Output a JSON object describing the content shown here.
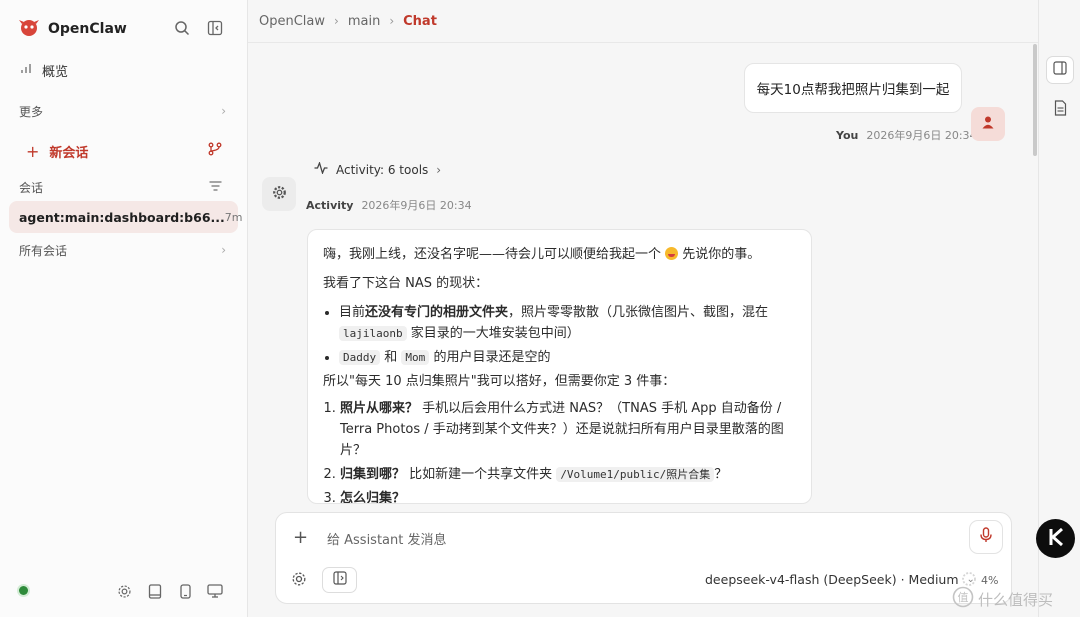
{
  "app": {
    "name": "OpenClaw"
  },
  "sidebar": {
    "overview_label": "概览",
    "more_label": "更多",
    "new_chat_label": "新会话",
    "sessions_label": "会话",
    "active_session": {
      "name": "agent:main:dashboard:b66...",
      "age": "7m"
    },
    "all_sessions_label": "所有会话"
  },
  "breadcrumb": {
    "items": [
      "OpenClaw",
      "main",
      "Chat"
    ]
  },
  "chat": {
    "user_message": {
      "text": "每天10点帮我把照片归集到一起",
      "author": "You",
      "timestamp": "2026年9月6日 20:34"
    },
    "activity_toggle_label": "Activity: 6 tools",
    "assistant_message": {
      "author": "Activity",
      "timestamp": "2026年9月6日 20:34",
      "p1_a": "嗨，我刚上线，还没名字呢——待会儿可以顺便给我起一个",
      "p1_b": "先说你的事。",
      "p2": "我看了下这台 NAS 的现状：",
      "b1_pre": "目前",
      "b1_bold": "还没有专门的相册文件夹",
      "b1_post": "，照片零零散散（几张微信图片、截图，混在",
      "b1_code": "lajilaonb",
      "b1_end": "家目录的一大堆安装包中间）",
      "b2_code1": "Daddy",
      "b2_mid": "和",
      "b2_code2": "Mom",
      "b2_end": "的用户目录还是空的",
      "p3": "所以\"每天 10 点归集照片\"我可以搭好，但需要你定 3 件事：",
      "o1_bold": "照片从哪来？",
      "o1_text": "手机以后会用什么方式进 NAS？（TNAS 手机 App 自动备份 / Terra Photos / 手动拷到某个文件夹？）还是说就扫所有用户目录里散落的图片？",
      "o2_bold": "归集到哪？",
      "o2_text": "比如新建一个共享文件夹",
      "o2_code": "/Volume1/public/照片合集",
      "o2_end": "？",
      "o3_bold": "怎么归集？"
    }
  },
  "composer": {
    "placeholder": "给 Assistant 发消息",
    "model_label": "deepseek-v4-flash (DeepSeek) · Medium",
    "context_usage": "4%"
  },
  "badge": {
    "letter": "K"
  },
  "watermark": {
    "text": "什么值得买"
  },
  "colors": {
    "accent": "#c0392b",
    "online": "#2e8b3a",
    "brand_red": "#d8453a"
  }
}
